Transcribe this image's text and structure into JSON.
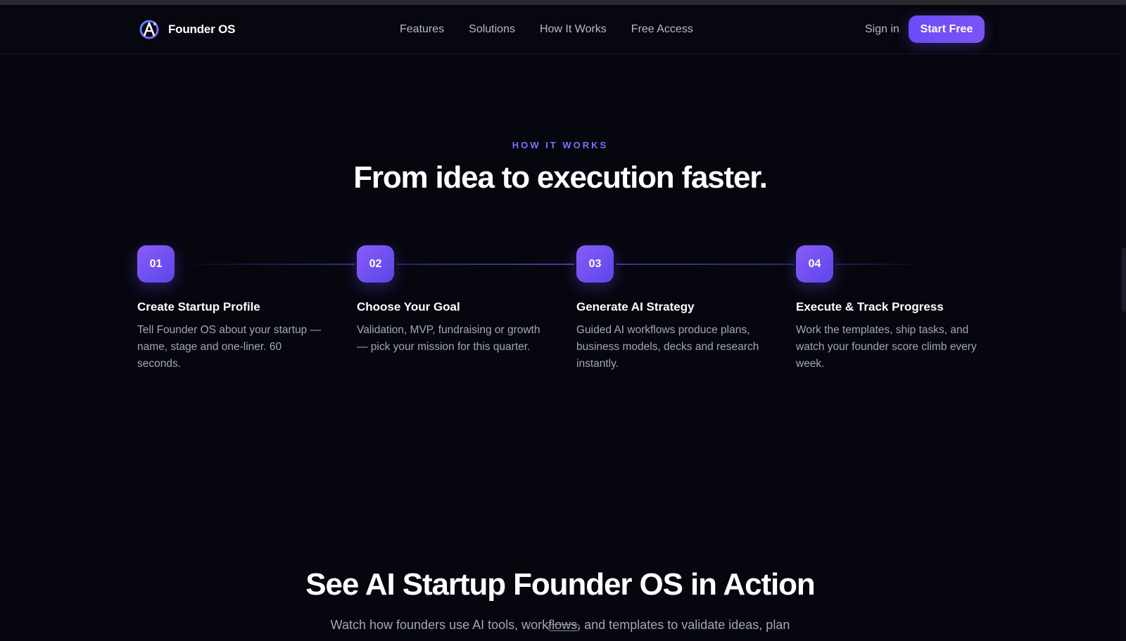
{
  "brand": {
    "name": "Founder OS",
    "logo_icon": "founder-os-logo-icon",
    "accent": "#6a4cf6"
  },
  "nav": {
    "links": [
      "Features",
      "Solutions",
      "How It Works",
      "Free Access"
    ],
    "signin_label": "Sign in",
    "cta_label": "Start Free"
  },
  "how_it_works": {
    "eyebrow": "HOW IT WORKS",
    "title": "From idea to execution faster.",
    "steps": [
      {
        "number": "01",
        "title": "Create Startup Profile",
        "description": "Tell Founder OS about your startup — name, stage and one-liner. 60 seconds."
      },
      {
        "number": "02",
        "title": "Choose Your Goal",
        "description": "Validation, MVP, fundraising or growth — pick your mission for this quarter."
      },
      {
        "number": "03",
        "title": "Generate AI Strategy",
        "description": "Guided AI workflows produce plans, business models, decks and research instantly."
      },
      {
        "number": "04",
        "title": "Execute & Track Progress",
        "description": "Work the templates, ship tasks, and watch your founder score climb every week."
      }
    ]
  },
  "action": {
    "title": "See AI Startup Founder OS in Action",
    "subtitle": "Watch how founders use AI tools, workflows, and templates to validate ideas, plan"
  }
}
